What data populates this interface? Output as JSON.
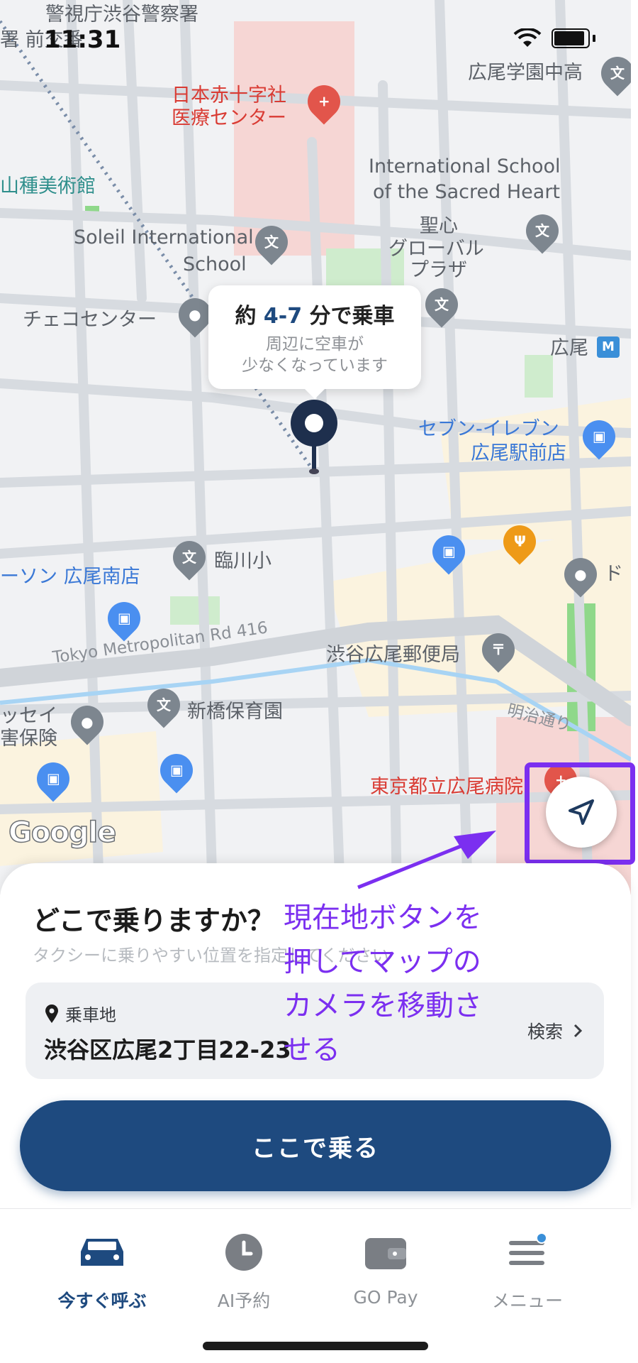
{
  "status_bar": {
    "time": "11:31"
  },
  "map": {
    "labels": {
      "police": "警視庁渋谷警察署",
      "police2": "署 前交番",
      "red_cross_1": "日本赤十字社",
      "red_cross_2": "医療センター",
      "hiroo_gakuen": "広尾学園中高",
      "museum": "山種美術館",
      "intl_school_1": "International School",
      "intl_school_2": "of the Sacred Heart",
      "seishin_1": "聖心",
      "seishin_2": "グローバル",
      "seishin_3": "プラザ",
      "soleil_1": "Soleil International",
      "soleil_2": "School",
      "czech": "チェコセンター",
      "hiroo_station": "広尾",
      "seven_1": "セブン-イレブン",
      "seven_2": "広尾駅前店",
      "rinsen": "臨川小",
      "lawson": "ーソン 広尾南店",
      "do": "ド",
      "road_416": "Tokyo Metropolitan Rd 416",
      "post_office": "渋谷広尾郵便局",
      "meiji_dori": "明治通り",
      "sei_1": "ッセイ",
      "sei_2": "害保険",
      "shinbashi": "新橋保育園",
      "hospital": "東京都立広尾病院"
    },
    "google_logo": "Google"
  },
  "eta": {
    "prefix": "約 ",
    "range": "4-7",
    "suffix": " 分で乗車",
    "sub_line1": "周辺に空車が",
    "sub_line2": "少なくなっています"
  },
  "sheet": {
    "title": "どこで乗りますか？",
    "subtitle": "タクシーに乗りやすい位置を指定してください",
    "pickup_label": "乗車地",
    "pickup_address": "渋谷区広尾2丁目22-23",
    "search_label": "検索",
    "ride_button": "ここで乗る"
  },
  "annotation": {
    "line1": "現在地ボタンを",
    "line2": "押してマップの",
    "line3": "カメラを移動さ",
    "line4": "せる"
  },
  "tabs": [
    {
      "label": "今すぐ呼ぶ",
      "active": true
    },
    {
      "label": "AI予約",
      "active": false
    },
    {
      "label": "GO Pay",
      "active": false
    },
    {
      "label": "メニュー",
      "active": false
    }
  ],
  "colors": {
    "brand_navy": "#1e4a7f",
    "annotation_purple": "#7b2ff0",
    "notification_dot": "#3a8fd8"
  }
}
